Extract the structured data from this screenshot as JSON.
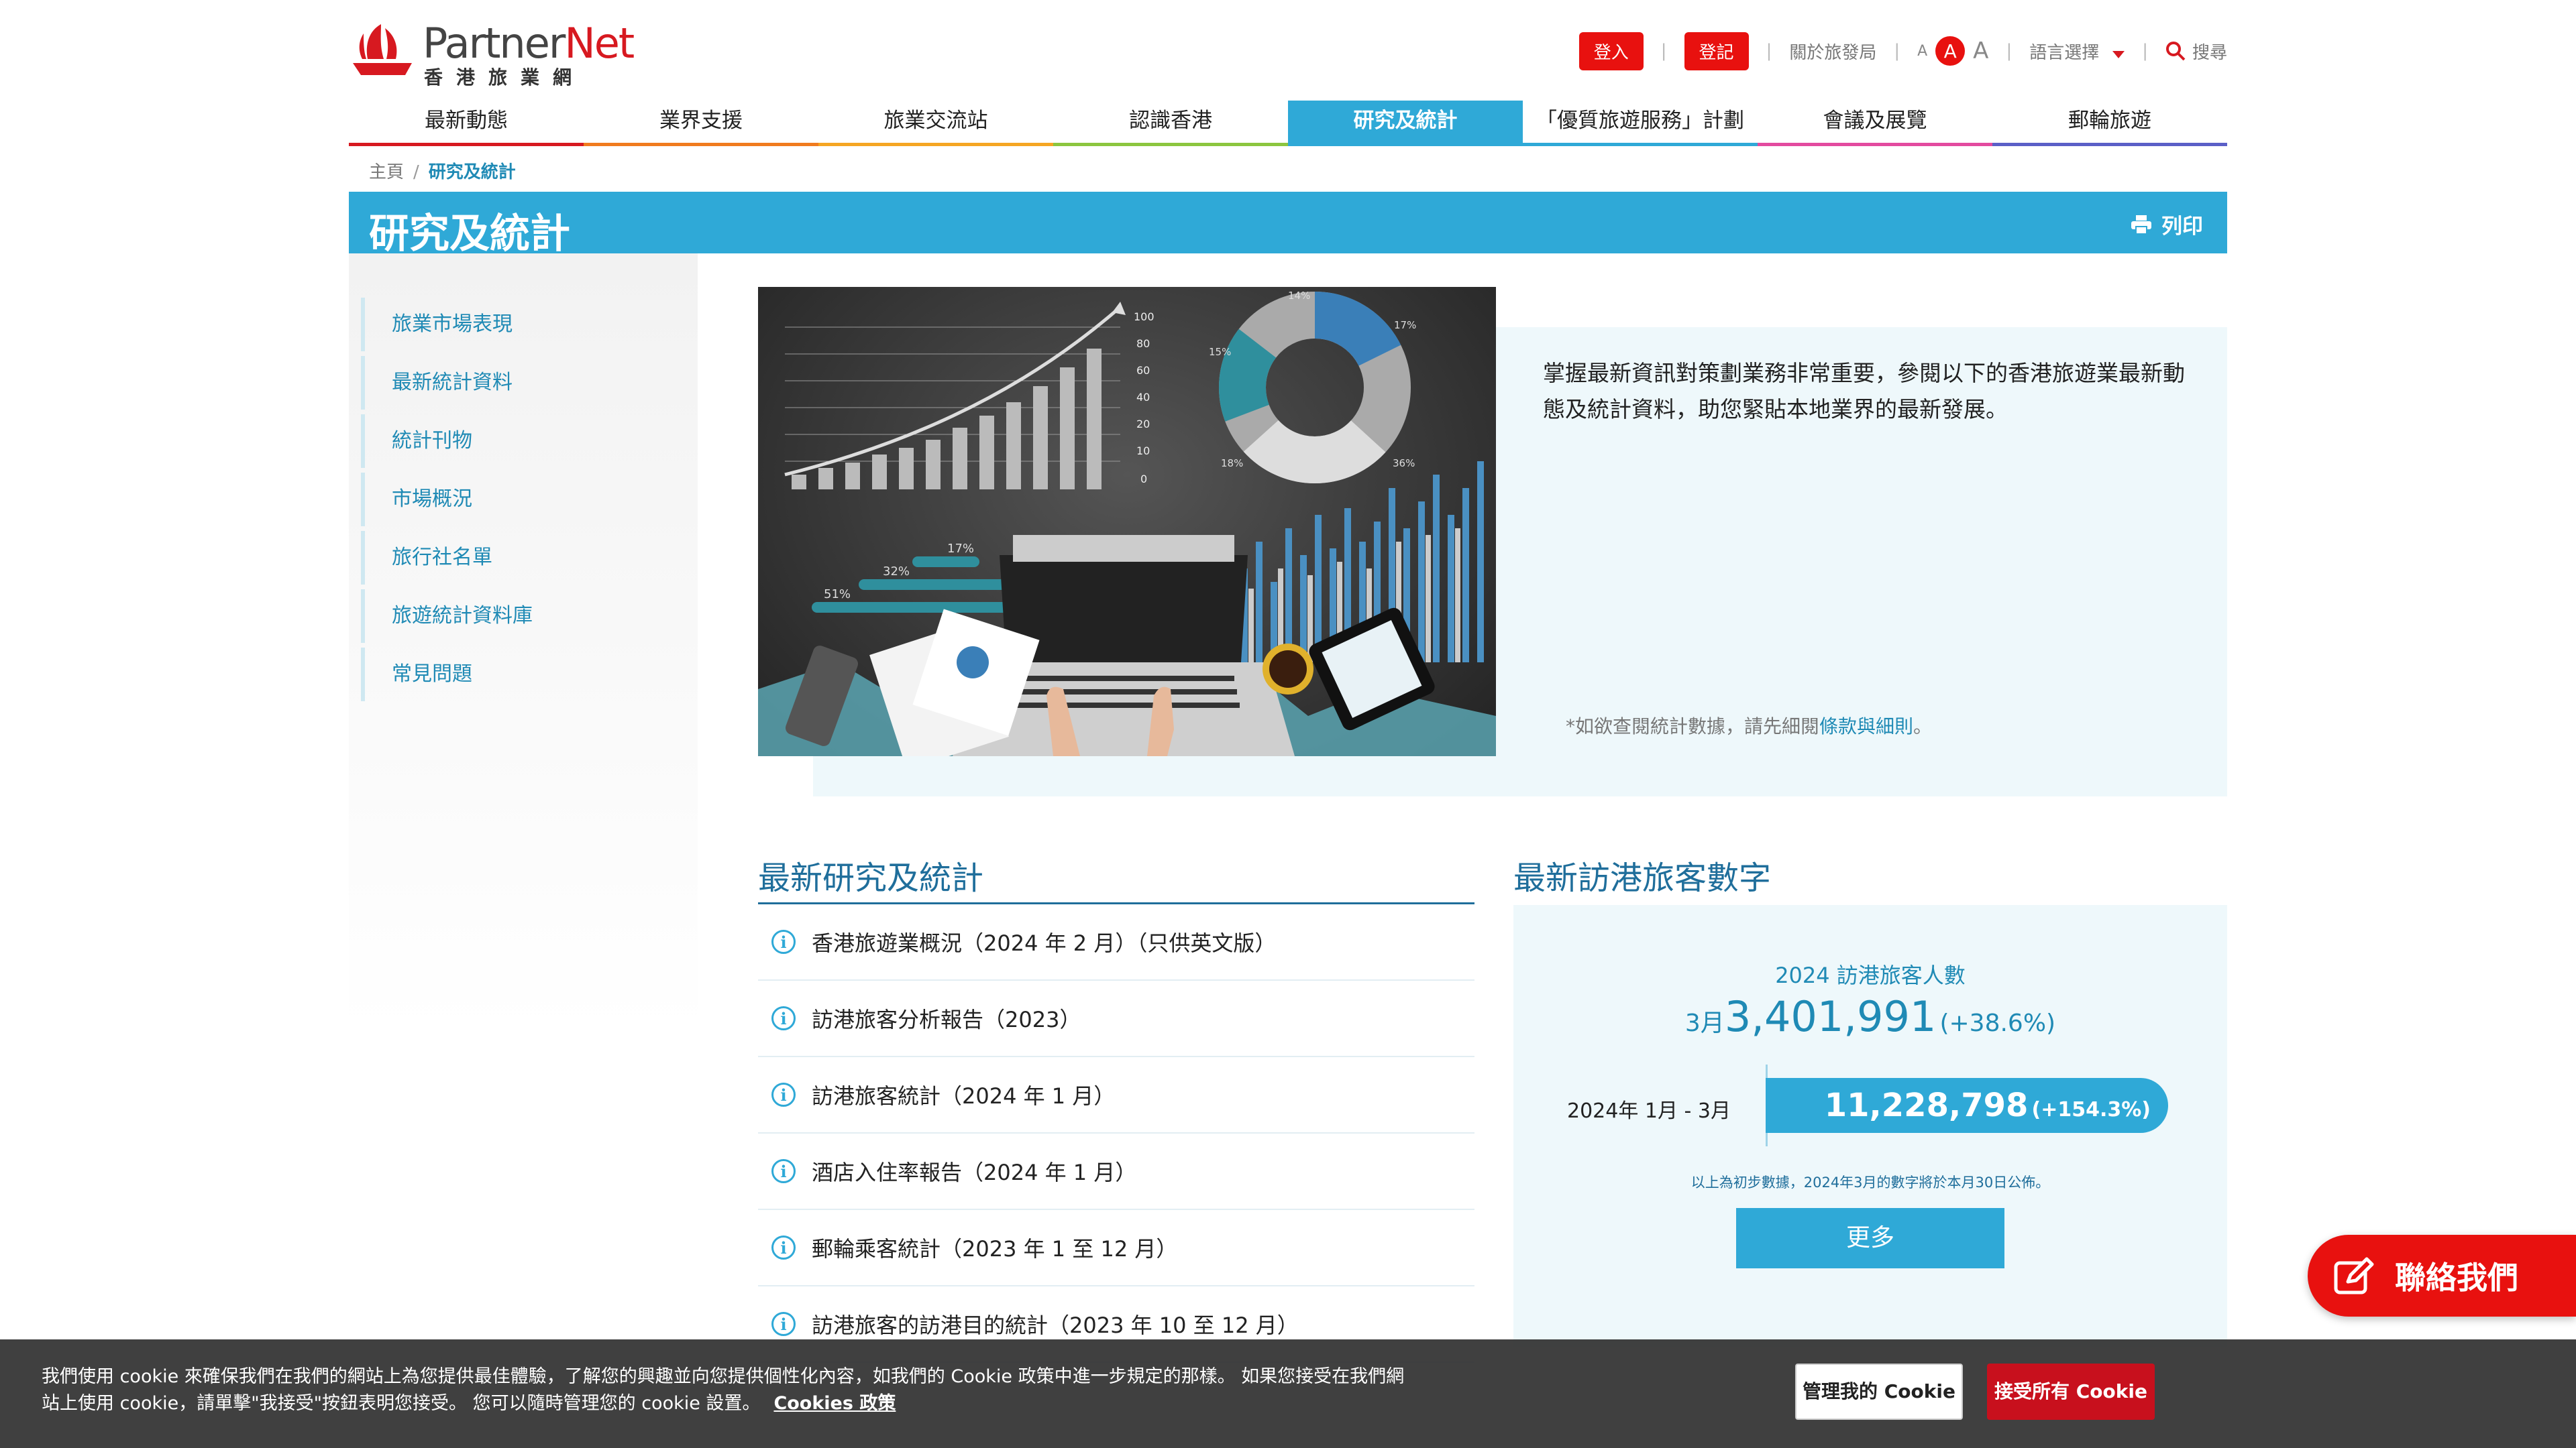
{
  "header": {
    "logo_word_a": "Partner",
    "logo_word_b": "Net",
    "logo_sub": "香港旅業網",
    "login": "登入",
    "register": "登記",
    "about": "關於旅發局",
    "font_small": "A",
    "font_medium": "A",
    "font_large": "A",
    "language": "語言選擇",
    "search": "搜尋"
  },
  "nav": {
    "items": [
      {
        "label": "最新動態",
        "color": "#d71920"
      },
      {
        "label": "業界支援",
        "color": "#f07b1f"
      },
      {
        "label": "旅業交流站",
        "color": "#f5a623"
      },
      {
        "label": "認識香港",
        "color": "#8cc63f"
      },
      {
        "label": "研究及統計",
        "color": "#2fa9d7"
      },
      {
        "label": "「優質旅遊服務」計劃",
        "color": "#2fa9d7"
      },
      {
        "label": "會議及展覽",
        "color": "#e34a9f"
      },
      {
        "label": "郵輪旅遊",
        "color": "#5b5fc7"
      }
    ],
    "active_index": 4
  },
  "breadcrumb": {
    "home": "主頁",
    "separator": "/",
    "current": "研究及統計"
  },
  "banner": {
    "title": "研究及統計",
    "print": "列印"
  },
  "sidebar": {
    "items": [
      {
        "label": "旅業市場表現"
      },
      {
        "label": "最新統計資料"
      },
      {
        "label": "統計刊物"
      },
      {
        "label": "市場概況"
      },
      {
        "label": "旅行社名單"
      },
      {
        "label": "旅遊統計資料庫"
      },
      {
        "label": "常見問題"
      }
    ]
  },
  "hero": {
    "text": "掌握最新資訊對策劃業務非常重要，參閱以下的香港旅遊業最新動態及統計資料，助您緊貼本地業界的最新發展。",
    "note_prefix": "*如欲查閱統計數據，請先細閱",
    "note_link": "條款與細則",
    "note_suffix": "。",
    "image_labels": {
      "axis": [
        "100",
        "80",
        "60",
        "40",
        "20",
        "10",
        "0"
      ],
      "donut": [
        "14%",
        "17%",
        "15%",
        "18%",
        "36%"
      ],
      "bars": [
        "17%",
        "32%",
        "51%"
      ]
    }
  },
  "research": {
    "title": "最新研究及統計",
    "items": [
      {
        "label": "香港旅遊業概況（2024 年 2 月）（只供英文版）"
      },
      {
        "label": "訪港旅客分析報告（2023）"
      },
      {
        "label": "訪港旅客統計（2024 年 1 月）"
      },
      {
        "label": "酒店入住率報告（2024 年 1 月）"
      },
      {
        "label": "郵輪乘客統計（2023 年 1 至 12 月）"
      },
      {
        "label": "訪港旅客的訪港目的統計（2023 年 10 至 12 月）"
      }
    ]
  },
  "stats": {
    "title": "最新訪港旅客數字",
    "year_label": "2024 訪港旅客人數",
    "month": "3月",
    "month_value": "3,401,991",
    "month_change": "(+38.6%)",
    "range_label": "2024年 1月 - 3月",
    "range_value": "11,228,798",
    "range_change": "(+154.3%)",
    "note": "以上為初步數據，2024年3月的數字將於本月30日公佈。",
    "more": "更多"
  },
  "contact": {
    "label": "聯絡我們"
  },
  "cookie": {
    "text": "我們使用 cookie 來確保我們在我們的網站上為您提供最佳體驗，了解您的興趣並向您提供個性化內容，如我們的 Cookie 政策中進一步規定的那樣。 如果您接受在我們網站上使用 cookie，請單擊\"我接受\"按鈕表明您接受。 您可以隨時管理您的 cookie 設置。",
    "policy": "Cookies 政策",
    "manage": "管理我的 Cookie",
    "accept": "接受所有 Cookie"
  }
}
